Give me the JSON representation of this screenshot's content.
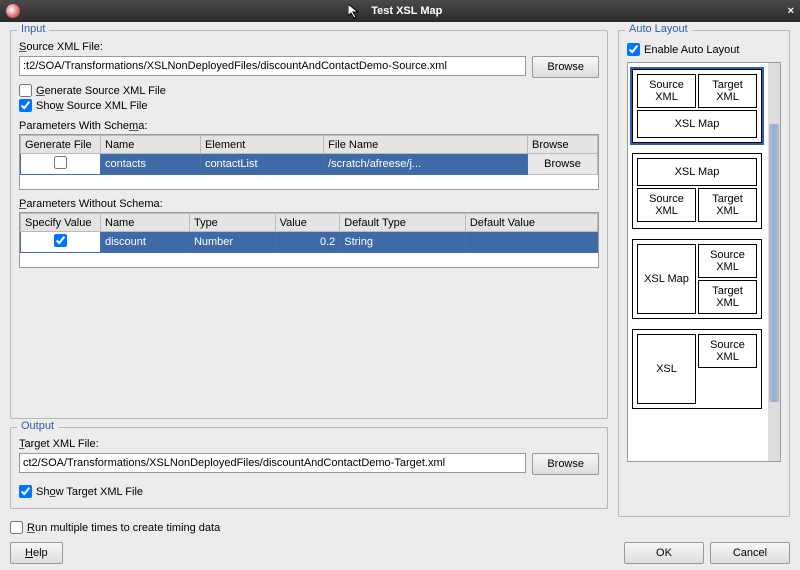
{
  "title": "Test XSL Map",
  "input": {
    "legend": "Input",
    "sourceLabel": "Source XML File:",
    "sourcePath": ":t2/SOA/Transformations/XSLNonDeployedFiles/discountAndContactDemo-Source.xml",
    "browse": "Browse",
    "generateSource": "Generate Source XML File",
    "showSource": "Show Source XML File",
    "paramsWithSchemaLabel": "Parameters With Schema:",
    "paramsWithSchema": {
      "headers": [
        "Generate File",
        "Name",
        "Element",
        "File Name",
        "Browse"
      ],
      "row": {
        "name": "contacts",
        "element": "contactList",
        "file": "/scratch/afreese/j...",
        "browse": "Browse"
      }
    },
    "paramsWithoutSchemaLabel": "Parameters Without Schema:",
    "paramsWithoutSchema": {
      "headers": [
        "Specify Value",
        "Name",
        "Type",
        "Value",
        "Default Type",
        "Default Value"
      ],
      "row": {
        "name": "discount",
        "type": "Number",
        "value": "0.2",
        "defType": "String",
        "defVal": ""
      }
    }
  },
  "output": {
    "legend": "Output",
    "targetLabel": "Target XML File:",
    "targetPath": "ct2/SOA/Transformations/XSLNonDeployedFiles/discountAndContactDemo-Target.xml",
    "browse": "Browse",
    "showTarget": "Show Target XML File"
  },
  "autoLayout": {
    "legend": "Auto Layout",
    "enable": "Enable Auto Layout",
    "cells": {
      "sourceXml": "Source XML",
      "targetXml": "Target XML",
      "xslMap": "XSL Map",
      "xsl": "XSL"
    }
  },
  "runMultiple": "Run multiple times to create timing data",
  "buttons": {
    "help": "Help",
    "ok": "OK",
    "cancel": "Cancel"
  }
}
